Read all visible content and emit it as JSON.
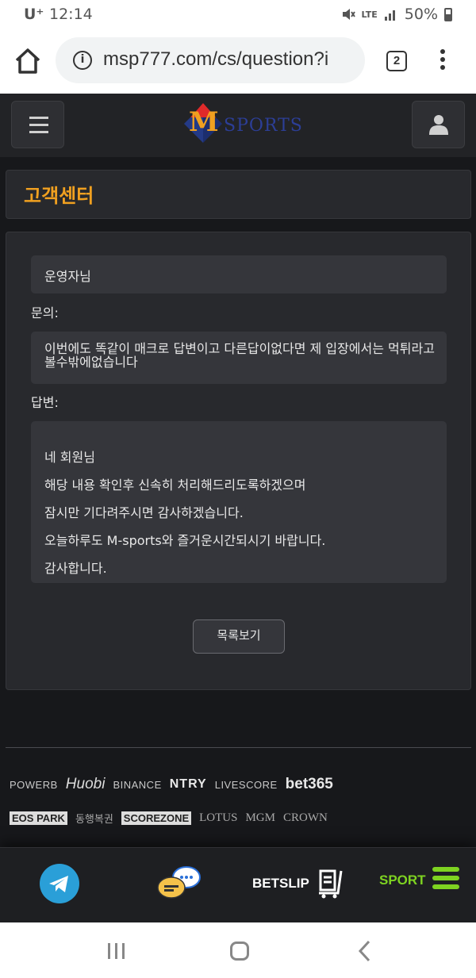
{
  "status_bar": {
    "carrier": "U⁺",
    "time": "12:14",
    "network": "LTE",
    "battery": "50%"
  },
  "browser": {
    "url": "msp777.com/cs/question?i",
    "tab_count": "2"
  },
  "site": {
    "logo_letter": "M",
    "logo_text": "SPORTS",
    "page_title": "고객센터",
    "subject": "운영자님",
    "question_label": "문의:",
    "question_text": "이번에도 똑같이 매크로 답변이고 다른답이없다면 제 입장에서는 먹튀라고볼수밖에없습니다",
    "answer_label": "답변:",
    "answer_lines": [
      "네 회원님",
      "해당 내용 확인후 신속히 처리해드리도록하겠으며",
      "잠시만 기다려주시면 감사하겠습니다.",
      "오늘하루도 M-sports와 즐거운시간되시기 바랍니다.",
      "감사합니다."
    ],
    "list_button": "목록보기"
  },
  "partners": {
    "row1": [
      "POWERB",
      "Huobi",
      "BINANCE",
      "NTRY",
      "LIVESCORE",
      "bet365"
    ],
    "row2": [
      "EOS PARK",
      "동행복권",
      "SCOREZONE",
      "LOTUS",
      "MGM",
      "CROWN"
    ]
  },
  "bottom_nav": {
    "betslip": "BETSLIP",
    "sport": "SPORT"
  },
  "colors": {
    "accent": "#f0a020",
    "sport_green": "#7ed321",
    "telegram": "#2a9fd8"
  }
}
